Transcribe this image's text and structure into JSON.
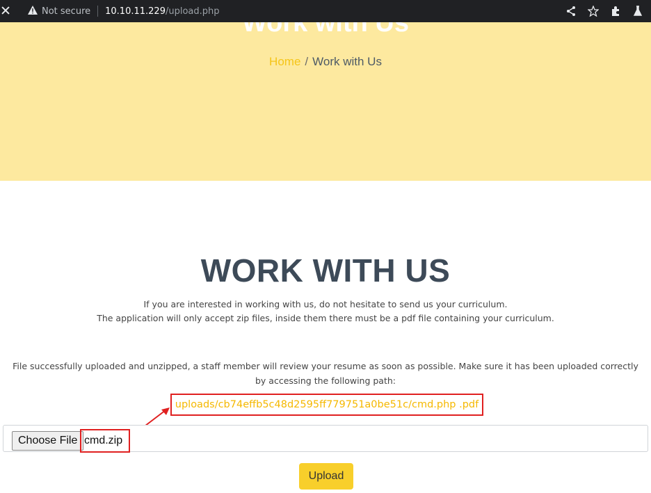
{
  "browser": {
    "security_label": "Not secure",
    "url_host": "10.10.11.229",
    "url_path": "/upload.php",
    "icons": [
      "close-icon",
      "warning-icon",
      "share-icon",
      "star-icon",
      "extensions-icon",
      "labs-icon"
    ]
  },
  "hero": {
    "title": "Work with Us",
    "breadcrumb": {
      "home": "Home",
      "separator": "/",
      "current": "Work with Us"
    }
  },
  "main": {
    "title": "WORK WITH US",
    "intro_line1": "If you are interested in working with us, do not hesitate to send us your curriculum.",
    "intro_line2": "The application will only accept zip files, inside them there must be a pdf file containing your curriculum.",
    "success_message": "File successfully uploaded and unzipped, a staff member will review your resume as soon as possible. Make sure it has been uploaded correctly by accessing the following path:",
    "uploaded_path": "uploads/cb74effb5c48d2595ff779751a0be51c/cmd.php .pdf"
  },
  "form": {
    "choose_file_label": "Choose File",
    "selected_file": "cmd.zip",
    "upload_label": "Upload"
  },
  "colors": {
    "hero_bg": "#fde99f",
    "accent_yellow": "#f5c518",
    "upload_button": "#f8cf2b",
    "annotation_red": "#e02020",
    "heading": "#3d4a58"
  }
}
